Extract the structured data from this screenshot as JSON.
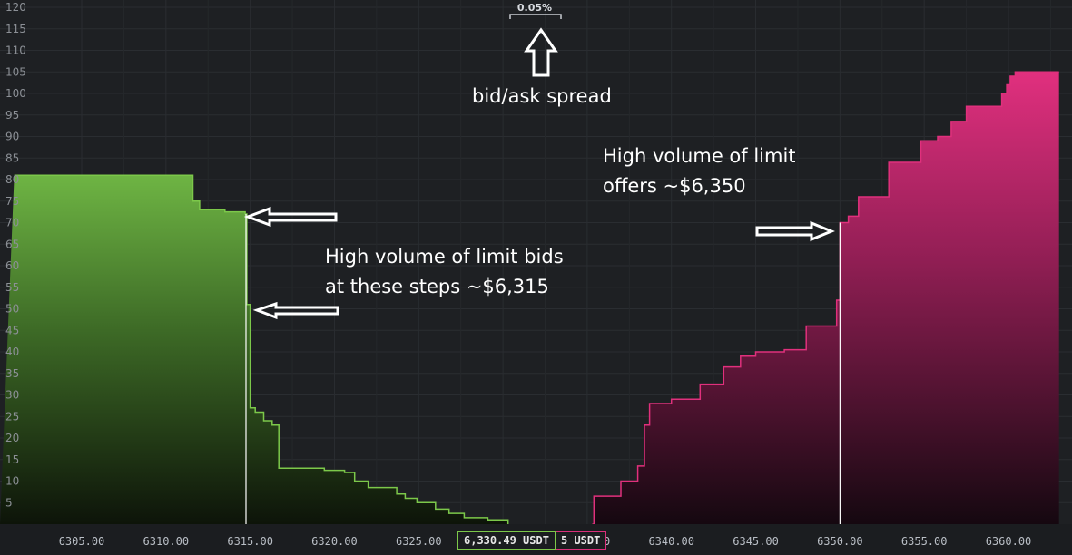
{
  "chart_data": {
    "type": "area",
    "title": "",
    "xlabel": "",
    "ylabel": "",
    "xlim": [
      6301.0,
      6363.0
    ],
    "ylim": [
      0,
      120
    ],
    "grid": true,
    "y_ticks": [
      5,
      10,
      15,
      20,
      25,
      30,
      35,
      40,
      45,
      50,
      55,
      60,
      65,
      70,
      75,
      80,
      85,
      90,
      95,
      100,
      105,
      110,
      115,
      120
    ],
    "x_ticks": [
      6305,
      6310,
      6315,
      6320,
      6325,
      6330,
      6335,
      6340,
      6345,
      6350,
      6355,
      6360
    ],
    "x_tick_labels": [
      "6305.00",
      "6310.00",
      "6315.00",
      "6320.00",
      "6325.00",
      "6330.00",
      "6335.00",
      "6340.00",
      "6345.00",
      "6350.00",
      "6355.00",
      "6360.00"
    ],
    "series": [
      {
        "side": "bids",
        "color": "#7cc84a",
        "x": [
          6301.0,
          6311.3,
          6311.6,
          6312.0,
          6313.5,
          6314.7,
          6314.8,
          6315.0,
          6315.3,
          6315.8,
          6316.3,
          6316.7,
          6317.4,
          6318.3,
          6319.4,
          6320.6,
          6321.2,
          6322.0,
          6323.7,
          6324.2,
          6324.9,
          6326.0,
          6326.8,
          6327.7,
          6329.1,
          6330.3
        ],
        "values": [
          81,
          81,
          75,
          73,
          72.5,
          72,
          51,
          27,
          26,
          24,
          23,
          13,
          13,
          13,
          12.5,
          12,
          10,
          8.5,
          7,
          6,
          5,
          3.5,
          2.5,
          1.5,
          1,
          0
        ]
      },
      {
        "side": "asks",
        "color": "#e0307c",
        "x": [
          6335.3,
          6335.4,
          6337.0,
          6338.0,
          6338.4,
          6338.7,
          6340.0,
          6341.7,
          6343.1,
          6344.1,
          6345.0,
          6346.7,
          6348.0,
          6349.8,
          6350.0,
          6350.5,
          6351.1,
          6352.9,
          6354.8,
          6355.8,
          6356.6,
          6357.5,
          6359.6,
          6359.9,
          6360.1,
          6360.4,
          6363.0
        ],
        "values": [
          0,
          6.5,
          10,
          13.5,
          23,
          28,
          29,
          32.5,
          36.5,
          39,
          40,
          40.5,
          46,
          52,
          70,
          71.5,
          76,
          84,
          89,
          90,
          93.5,
          97,
          100,
          102,
          104,
          105,
          105
        ]
      }
    ],
    "spread_label": "0.05%",
    "mid_price_label": "6,330.49 USDT",
    "ask_price_label": "5 USDT",
    "annotations": {
      "spread": "bid/ask spread",
      "bids": [
        "High volume of limit bids",
        "at these steps ~$6,315"
      ],
      "offers": [
        "High volume of limit",
        "offers ~$6,350"
      ]
    }
  }
}
